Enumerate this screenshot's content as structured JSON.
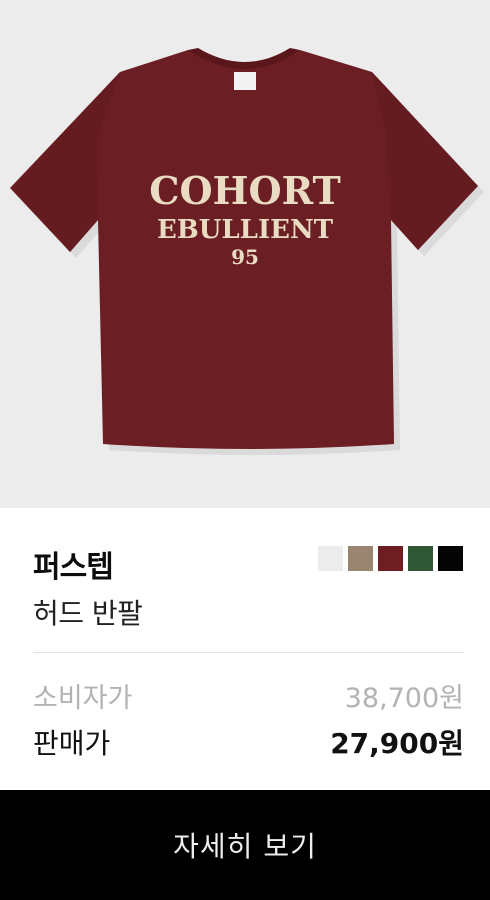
{
  "product": {
    "image_alt": "COHORT EBULLIENT 95 burgundy t-shirt",
    "print_line1": "COHORT",
    "print_line2": "EBULLIENT",
    "print_line3": "95",
    "brand": "퍼스텝",
    "name": "허드 반팔",
    "colors": [
      {
        "name": "white",
        "hex": "#ececec"
      },
      {
        "name": "beige",
        "hex": "#9a8571"
      },
      {
        "name": "burgundy",
        "hex": "#6e1e22"
      },
      {
        "name": "green",
        "hex": "#2f5635"
      },
      {
        "name": "black",
        "hex": "#050505"
      }
    ]
  },
  "pricing": {
    "retail_label": "소비자가",
    "retail_value": "38,700원",
    "sale_label": "판매가",
    "sale_value": "27,900원"
  },
  "cta": {
    "label": "자세히 보기"
  },
  "colors": {
    "shirt": "#6b1e23",
    "print": "#e9dcc2",
    "background": "#ececec"
  }
}
